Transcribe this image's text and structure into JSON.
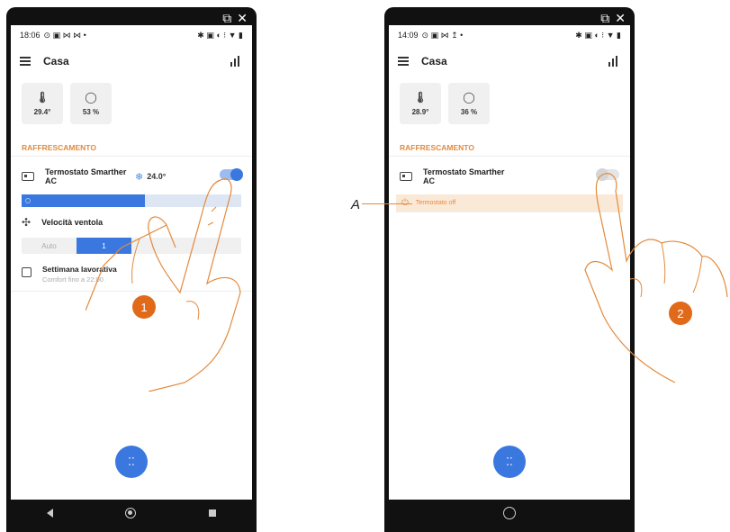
{
  "left": {
    "status_time": "18:06",
    "status_icons": "⊙ ▣ ⋈ ⋈ •",
    "status_right": "✱ ▣ ◐ ⁝ ▼ ▮",
    "app_title": "Casa",
    "temperature": "29.4°",
    "humidity": "53 %",
    "section": "RAFFRESCAMENTO",
    "thermostat_name": "Termostato Smarther AC",
    "setpoint": "24.0°",
    "slider_fill": 0.56,
    "fan_label": "Velocità ventola",
    "fan_options": [
      "Auto",
      "1",
      "",
      ""
    ],
    "fan_selected": 1,
    "schedule_title": "Settimana lavorativa",
    "schedule_sub": "Comfort fino a 22:00",
    "step": "1"
  },
  "right": {
    "status_time": "14:09",
    "status_icons": "⊙ ▣ ⋈ ↥ •",
    "status_right": "✱ ▣ ◐ ⁝ ▼ ▮",
    "app_title": "Casa",
    "temperature": "28.9°",
    "humidity": "36 %",
    "section": "RAFFRESCAMENTO",
    "thermostat_name": "Termostato Smarther AC",
    "off_label": "Termostato off",
    "step": "2"
  },
  "callout": "A",
  "icons": {
    "thermometer": "🌡",
    "drop": "◯",
    "snow": "❄",
    "fan": "✣",
    "power": "⏻",
    "fab": "⁚⁚"
  },
  "colors": {
    "accent": "#3a78e0",
    "section": "#e38a3d",
    "step_badge": "#e06a1a"
  }
}
